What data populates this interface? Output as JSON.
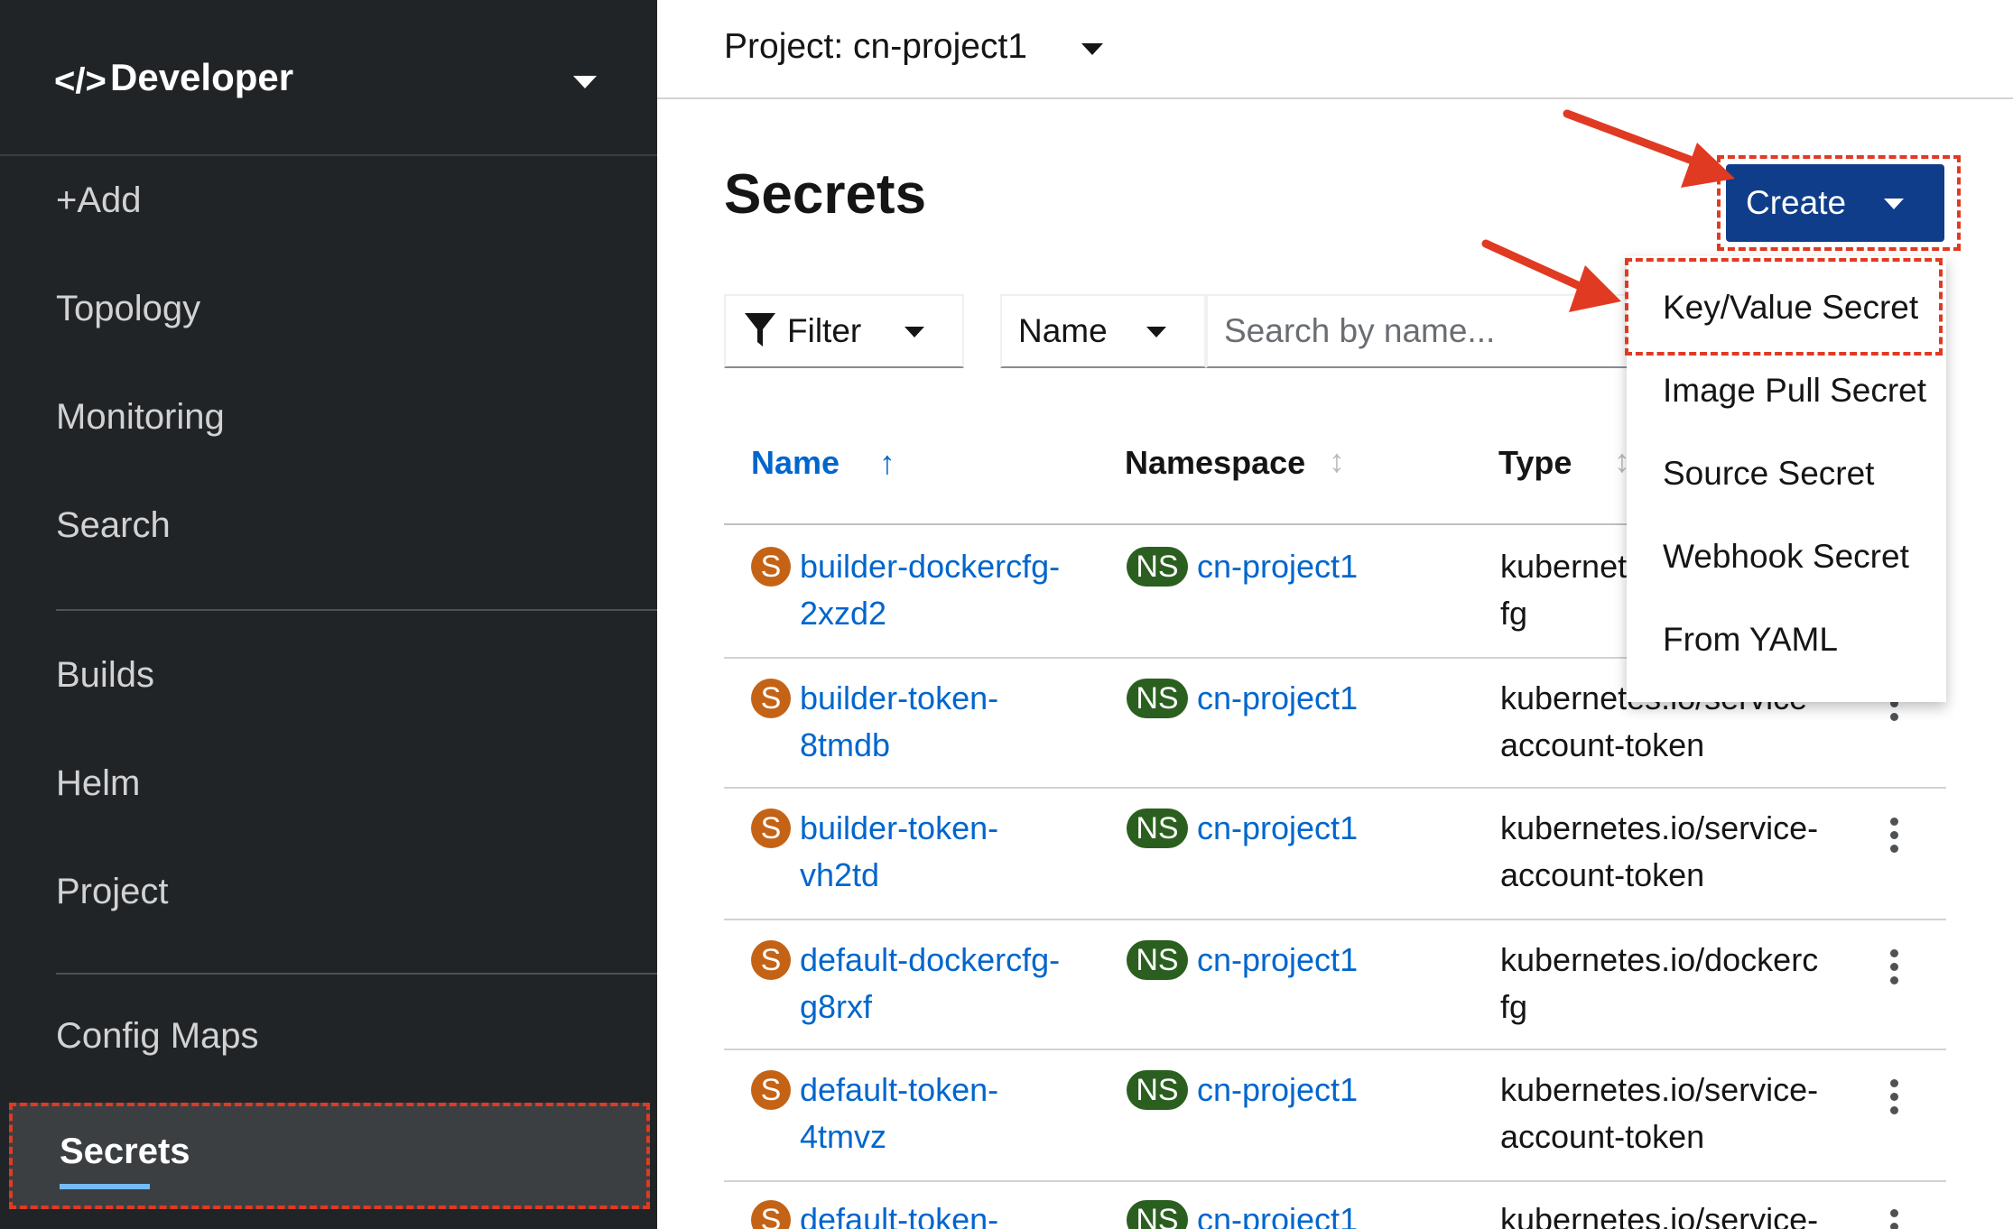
{
  "sidebar": {
    "perspective": {
      "icon": "code-icon",
      "label": "Developer"
    },
    "items": [
      {
        "label": "+Add"
      },
      {
        "label": "Topology"
      },
      {
        "label": "Monitoring"
      },
      {
        "label": "Search"
      },
      {
        "label": "Builds"
      },
      {
        "label": "Helm"
      },
      {
        "label": "Project"
      },
      {
        "label": "Config Maps"
      },
      {
        "label": "Secrets",
        "active": true
      }
    ]
  },
  "header": {
    "project_label": "Project: cn-project1"
  },
  "page": {
    "title": "Secrets"
  },
  "create": {
    "label": "Create",
    "menu": [
      "Key/Value Secret",
      "Image Pull Secret",
      "Source Secret",
      "Webhook Secret",
      "From YAML"
    ]
  },
  "toolbar": {
    "filter_label": "Filter",
    "name_select": "Name",
    "search_placeholder": "Search by name..."
  },
  "table": {
    "columns": [
      "Name",
      "Namespace",
      "Type"
    ],
    "rows": [
      {
        "badge": "S",
        "name_line1": "builder-dockercfg-",
        "name_line2": "2xzd2",
        "ns_badge": "NS",
        "namespace": "cn-project1",
        "type_line1": "kubernet",
        "type_line2": "fg"
      },
      {
        "badge": "S",
        "name_line1": "builder-token-",
        "name_line2": "8tmdb",
        "ns_badge": "NS",
        "namespace": "cn-project1",
        "type_line1": "kubernetes.io/service-",
        "type_line2": "account-token"
      },
      {
        "badge": "S",
        "name_line1": "builder-token-",
        "name_line2": "vh2td",
        "ns_badge": "NS",
        "namespace": "cn-project1",
        "type_line1": "kubernetes.io/service-",
        "type_line2": "account-token"
      },
      {
        "badge": "S",
        "name_line1": "default-dockercfg-",
        "name_line2": "g8rxf",
        "ns_badge": "NS",
        "namespace": "cn-project1",
        "type_line1": "kubernetes.io/dockerc",
        "type_line2": "fg"
      },
      {
        "badge": "S",
        "name_line1": "default-token-",
        "name_line2": "4tmvz",
        "ns_badge": "NS",
        "namespace": "cn-project1",
        "type_line1": "kubernetes.io/service-",
        "type_line2": "account-token"
      },
      {
        "badge": "S",
        "name_line1": "default-token-",
        "name_line2": "",
        "ns_badge": "NS",
        "namespace": "cn-project1",
        "type_line1": "kubernetes.io/service-",
        "type_line2": ""
      }
    ]
  },
  "colors": {
    "accent": "#0066cc",
    "create_button": "#0f3d8a",
    "annotation": "#e03a22",
    "sidebar": "#212427"
  }
}
